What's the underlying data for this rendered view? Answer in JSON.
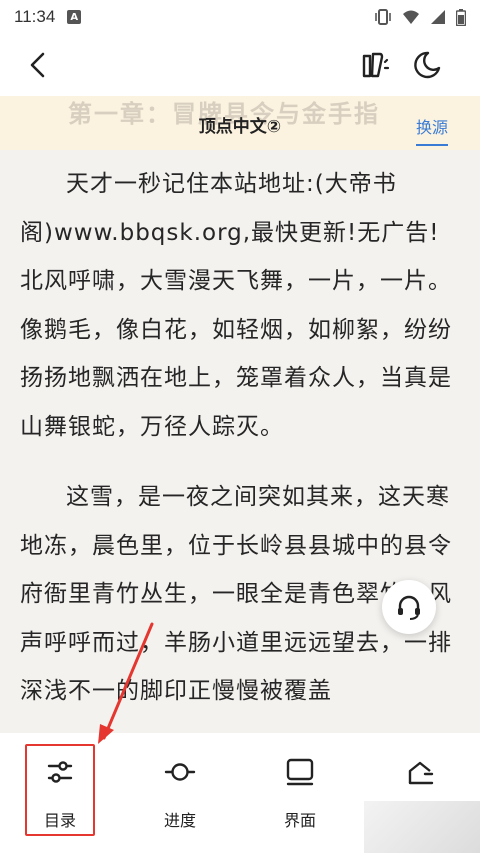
{
  "status": {
    "time": "11:34",
    "notif_letter": "A"
  },
  "colors": {
    "accent": "#3a7bd5",
    "annotation": "#e5372f",
    "source_bar_bg": "#fbf3e0"
  },
  "toolbar": {
    "back_icon": "chevron-left-icon",
    "tts_icon": "audio-read-icon",
    "night_icon": "moon-icon"
  },
  "source_bar": {
    "chapter_title": "第一章：冒牌县令与金手指",
    "source_name": "顶点中文②",
    "switch_label": "换源"
  },
  "content": {
    "paragraphs": [
      "天才一秒记住本站地址:(大帝书阁)www.bbqsk.org,最快更新!无广告! 北风呼啸，大雪漫天飞舞，一片，一片。像鹅毛，像白花，如轻烟，如柳絮，纷纷扬扬地飘洒在地上，笼罩着众人，当真是山舞银蛇，万径人踪灭。",
      "这雪，是一夜之间突如其来，这天寒地冻，晨色里，位于长岭县县城中的县令府衙里青竹丛生，一眼全是青色翠竹，风声呼呼而过，羊肠小道里远远望去，一排深浅不一的脚印正慢慢被覆盖"
    ]
  },
  "float_button": {
    "icon": "headset-icon"
  },
  "bottom_bar": {
    "tabs": [
      {
        "label": "目录",
        "icon": "catalog-sliders-icon"
      },
      {
        "label": "进度",
        "icon": "progress-icon"
      },
      {
        "label": "界面",
        "icon": "interface-icon"
      },
      {
        "label": "",
        "icon": "settings-icon"
      }
    ]
  }
}
